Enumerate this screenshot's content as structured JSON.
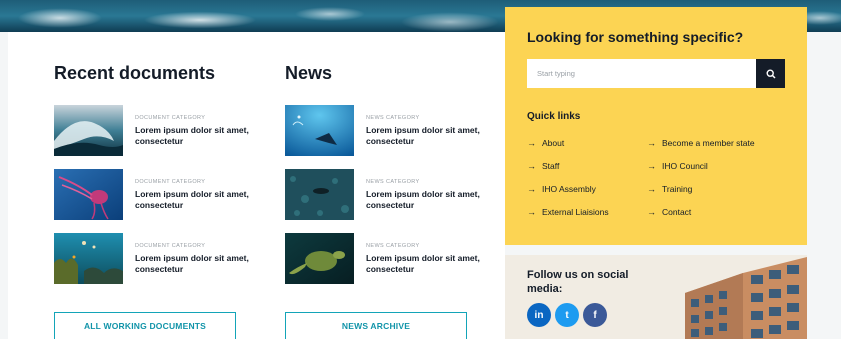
{
  "documents": {
    "title": "Recent documents",
    "items": [
      {
        "category": "DOCUMENT CATEGORY",
        "title": "Lorem ipsum dolor sit amet, consectetur",
        "image": "wave-photo"
      },
      {
        "category": "DOCUMENT CATEGORY",
        "title": "Lorem ipsum dolor sit amet, consectetur",
        "image": "jellyfish-photo"
      },
      {
        "category": "DOCUMENT CATEGORY",
        "title": "Lorem ipsum dolor sit amet, consectetur",
        "image": "coral-reef-photo"
      }
    ],
    "button_label": "ALL WORKING DOCUMENTS"
  },
  "news": {
    "title": "News",
    "items": [
      {
        "category": "NEWS CATEGORY",
        "title": "Lorem ipsum dolor sit amet, consectetur",
        "image": "manta-ray-photo"
      },
      {
        "category": "NEWS CATEGORY",
        "title": "Lorem ipsum dolor sit amet, consectetur",
        "image": "seabed-fish-photo"
      },
      {
        "category": "NEWS CATEGORY",
        "title": "Lorem ipsum dolor sit amet, consectetur",
        "image": "sea-turtle-photo"
      }
    ],
    "button_label": "NEWS ARCHIVE"
  },
  "search": {
    "title": "Looking for something specific?",
    "placeholder": "Start typing",
    "button_icon": "search-icon"
  },
  "quick_links": {
    "title": "Quick links",
    "left": [
      "About",
      "Staff",
      "IHO Assembly",
      "External Liaisions"
    ],
    "right": [
      "Become a member state",
      "IHO Council",
      "Training",
      "Contact"
    ]
  },
  "social": {
    "title": "Follow us on social media:",
    "networks": [
      {
        "icon": "linkedin-icon",
        "label": "in",
        "color": "#0a66c2"
      },
      {
        "icon": "twitter-icon",
        "label": "t",
        "color": "#1d9bf0"
      },
      {
        "icon": "facebook-icon",
        "label": "f",
        "color": "#3b5998"
      }
    ]
  },
  "colors": {
    "accent_yellow": "#fcd453",
    "accent_teal": "#13a4b8",
    "dark": "#141c28"
  }
}
